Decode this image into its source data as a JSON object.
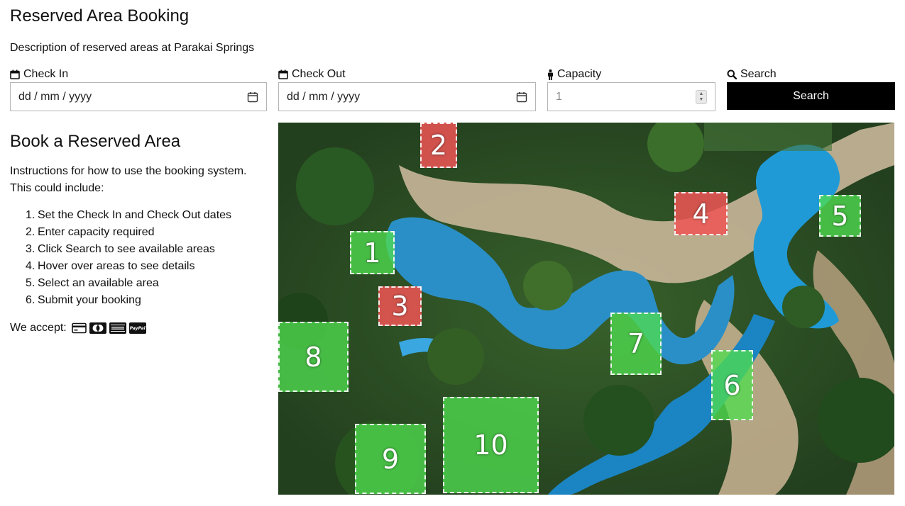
{
  "page": {
    "title": "Reserved Area Booking",
    "description": "Description of reserved areas at Parakai Springs"
  },
  "search_form": {
    "check_in": {
      "label": "Check In",
      "value": "dd / mm / yyyy",
      "icon": "calendar-icon"
    },
    "check_out": {
      "label": "Check Out",
      "value": "dd / mm / yyyy",
      "icon": "calendar-icon"
    },
    "capacity": {
      "label": "Capacity",
      "value": "1",
      "icon": "person-icon"
    },
    "search": {
      "label": "Search",
      "button_label": "Search",
      "icon": "search-icon"
    }
  },
  "booking": {
    "title": "Book a Reserved Area",
    "instructions": "Instructions for how to use the booking system. This could include:",
    "steps": [
      {
        "num": "1.",
        "text": "Set the Check In and Check Out dates"
      },
      {
        "num": "2.",
        "text": "Enter capacity required"
      },
      {
        "num": "3.",
        "text": "Click Search to see available areas"
      },
      {
        "num": "4.",
        "text": "Hover over areas to see details"
      },
      {
        "num": "5.",
        "text": "Select an available area"
      },
      {
        "num": "6.",
        "text": "Submit your booking"
      }
    ],
    "we_accept": "We accept:",
    "payment_methods": [
      "credit-card-icon",
      "mastercard-icon",
      "amex-icon",
      "paypal-icon"
    ],
    "paypal_text": "PayPal"
  },
  "map": {
    "areas": [
      {
        "id": "1",
        "status": "available"
      },
      {
        "id": "2",
        "status": "booked"
      },
      {
        "id": "3",
        "status": "booked"
      },
      {
        "id": "4",
        "status": "booked"
      },
      {
        "id": "5",
        "status": "available"
      },
      {
        "id": "6",
        "status": "available"
      },
      {
        "id": "7",
        "status": "available"
      },
      {
        "id": "8",
        "status": "available"
      },
      {
        "id": "9",
        "status": "available"
      },
      {
        "id": "10",
        "status": "available"
      }
    ],
    "colors": {
      "available": "#50dc50",
      "booked": "#f05555"
    }
  }
}
